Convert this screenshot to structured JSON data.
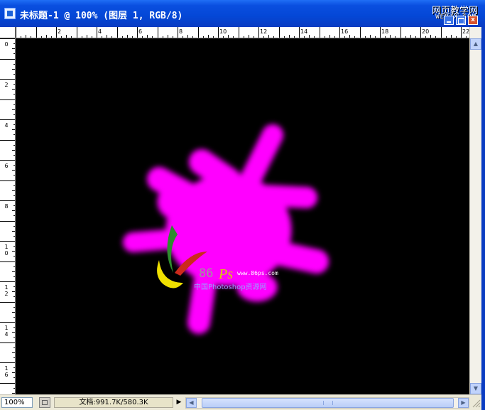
{
  "window": {
    "title": "未标题-1 @ 100% (图层 1, RGB/8)",
    "close_glyph": "x"
  },
  "watermark": {
    "site_cn": "网页教学网",
    "site_url": "WEBJX.COM"
  },
  "ruler": {
    "horizontal_labels": [
      "2",
      "4",
      "6",
      "8",
      "10",
      "12",
      "14",
      "16",
      "18",
      "20",
      "22"
    ],
    "vertical_labels": [
      "0",
      "2",
      "4",
      "6",
      "8",
      "1\n0",
      "1\n2",
      "1\n4",
      "1\n6"
    ]
  },
  "logo": {
    "brand_digits": "86",
    "brand_letters": "Ps",
    "url": "www.86ps.com",
    "tagline": "中国Photoshop资源网"
  },
  "status": {
    "zoom": "100%",
    "doc_info": "文档:991.7K/580.3K"
  },
  "colors": {
    "title_bar": "#0447d6",
    "canvas_bg": "#000000",
    "splash": "#ff00ff",
    "logo_green": "#2e8b2e",
    "logo_red": "#cc2a1c",
    "logo_yellow": "#f0e000"
  }
}
